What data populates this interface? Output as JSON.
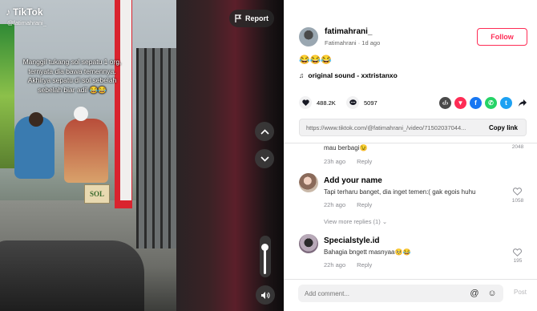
{
  "video": {
    "logo": "TikTok",
    "handle": "@fatimahrani_",
    "caption": "Manggil tukang sol sepatu 1 org, ternyata dia bawa temennya. Akhirya sepatu di sol sebelah sebelah biar adil 😂😂",
    "box_text": "SOL",
    "report_label": "Report"
  },
  "author": {
    "username": "fatimahrani_",
    "display": "Fatimahrani",
    "age": "1d ago",
    "follow_label": "Follow",
    "emojis": "😂😂😂",
    "sound": "original sound - xxtristanxo"
  },
  "stats": {
    "likes": "488.2K",
    "comments": "5097"
  },
  "share": {
    "url": "https://www.tiktok.com/@fatimahrani_/video/71502037044...",
    "copy_label": "Copy link"
  },
  "comments": [
    {
      "name": "",
      "text": "mau berbagi😉",
      "time": "23h ago",
      "reply": "Reply",
      "likes": "2048"
    },
    {
      "name": "Add your name",
      "text": "Tapi terharu banget, dia inget temen:( gak egois huhu",
      "time": "22h ago",
      "reply": "Reply",
      "likes": "1058",
      "more_replies": "View more replies (1)"
    },
    {
      "name": "Specialstyle.id",
      "text": "Bahagia bngett masnyaa🥺😂",
      "time": "22h ago",
      "reply": "Reply",
      "likes": "195"
    }
  ],
  "composer": {
    "placeholder": "Add comment...",
    "post_label": "Post"
  },
  "colors": {
    "accent": "#fe2c55",
    "share_embed": "#4a4a4a",
    "share_red": "#fe2c55",
    "share_fb": "#1877f2",
    "share_wa": "#25d366",
    "share_tw": "#1da1f2"
  }
}
